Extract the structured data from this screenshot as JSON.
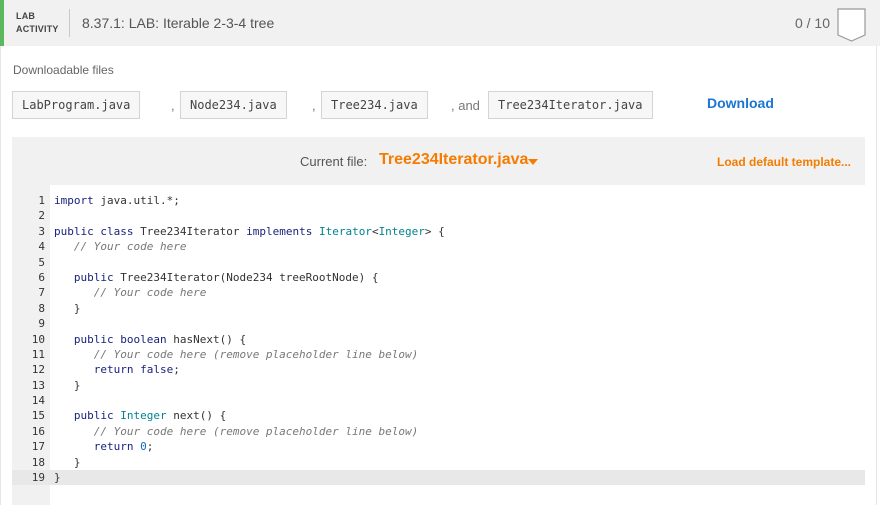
{
  "header": {
    "tag_line1": "LAB",
    "tag_line2": "ACTIVITY",
    "title": "8.37.1: LAB: Iterable 2-3-4 tree",
    "score": "0 / 10",
    "accent_color": "#5cb85c"
  },
  "downloads": {
    "label": "Downloadable files",
    "files": [
      "LabProgram.java",
      "Node234.java",
      "Tree234.java",
      "Tree234Iterator.java"
    ],
    "comma": ",",
    "and_text": ", and",
    "download_label": "Download"
  },
  "editor": {
    "current_label": "Current file:",
    "current_file": "Tree234Iterator.java",
    "load_default": "Load default template...",
    "accent_color": "#f57c00",
    "line_numbers": [
      "1",
      "2",
      "3",
      "4",
      "5",
      "6",
      "7",
      "8",
      "9",
      "10",
      "11",
      "12",
      "13",
      "14",
      "15",
      "16",
      "17",
      "18",
      "19"
    ],
    "lines": [
      "import java.util.*;",
      "",
      "public class Tree234Iterator implements Iterator<Integer> {",
      "   // Your code here",
      "",
      "   public Tree234Iterator(Node234 treeRootNode) {",
      "      // Your code here",
      "   }",
      "",
      "   public boolean hasNext() {",
      "      // Your code here (remove placeholder line below)",
      "      return false;",
      "   }",
      "",
      "   public Integer next() {",
      "      // Your code here (remove placeholder line below)",
      "      return 0;",
      "   }",
      "}"
    ]
  }
}
